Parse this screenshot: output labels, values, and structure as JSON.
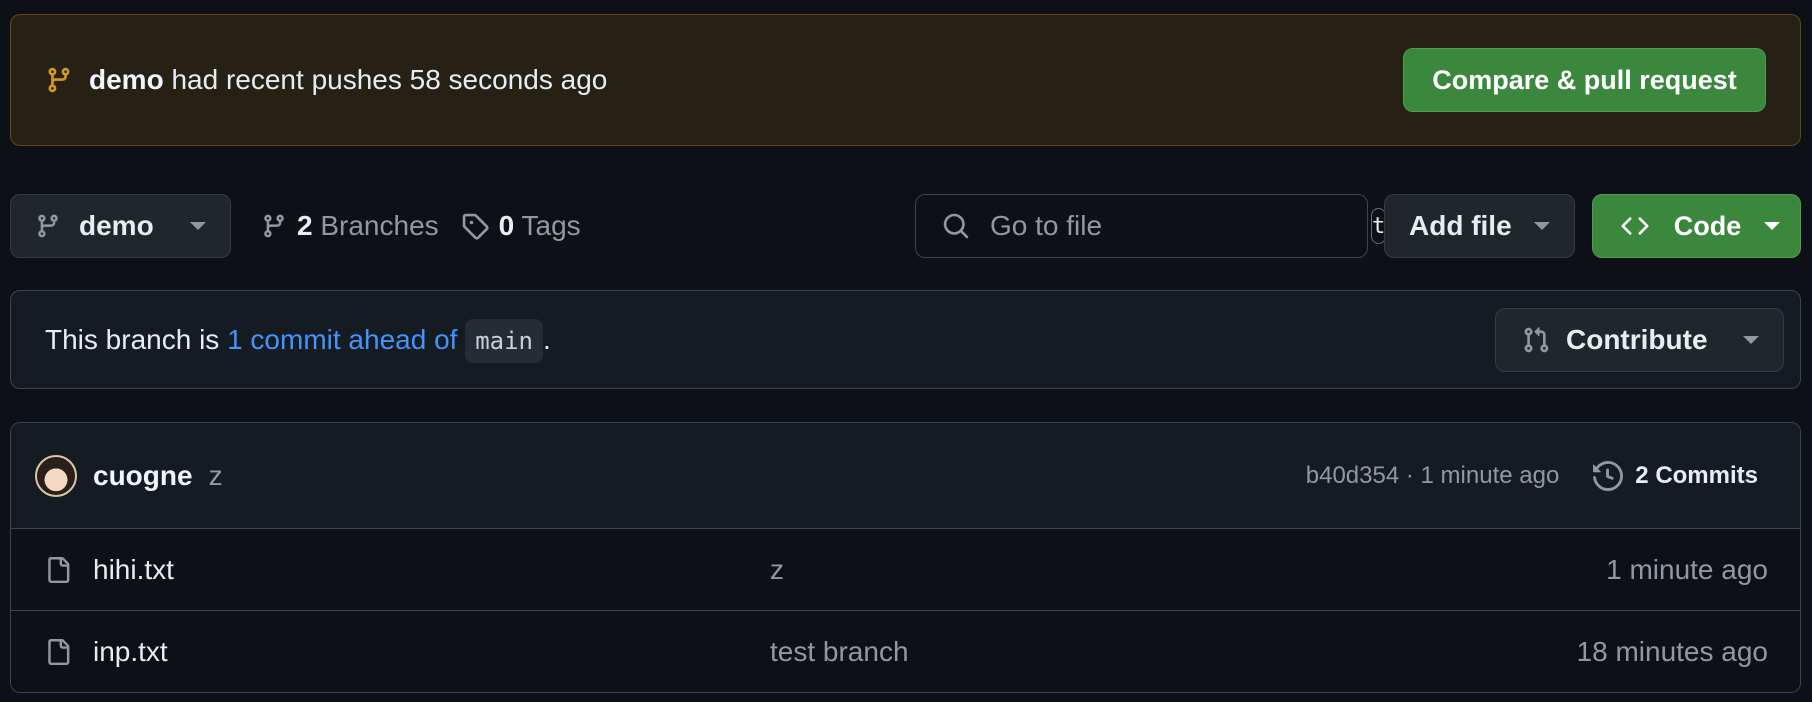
{
  "banner": {
    "branch": "demo",
    "text": "had recent pushes 58 seconds ago",
    "compare_label": "Compare & pull request"
  },
  "toolbar": {
    "branch_selector": "demo",
    "branches_count": "2",
    "branches_label": "Branches",
    "tags_count": "0",
    "tags_label": "Tags",
    "search_placeholder": "Go to file",
    "search_shortcut": "t",
    "add_file_label": "Add file",
    "code_label": "Code"
  },
  "ahead": {
    "prefix": "This branch is",
    "link": "1 commit ahead of",
    "base_branch": "main",
    "suffix": ".",
    "contribute_label": "Contribute"
  },
  "latest_commit": {
    "author": "cuogne",
    "message": "z",
    "hash_time": "b40d354 · 1 minute ago",
    "commits_label": "2 Commits"
  },
  "files": [
    {
      "name": "hihi.txt",
      "message": "z",
      "time": "1 minute ago"
    },
    {
      "name": "inp.txt",
      "message": "test branch",
      "time": "18 minutes ago"
    }
  ],
  "colors": {
    "background": "#0d1117",
    "banner_bg": "#272115",
    "green_button": "#3b873e",
    "link_blue": "#4493f8",
    "muted": "#9198a1",
    "branch_icon_accent": "#d29922"
  }
}
